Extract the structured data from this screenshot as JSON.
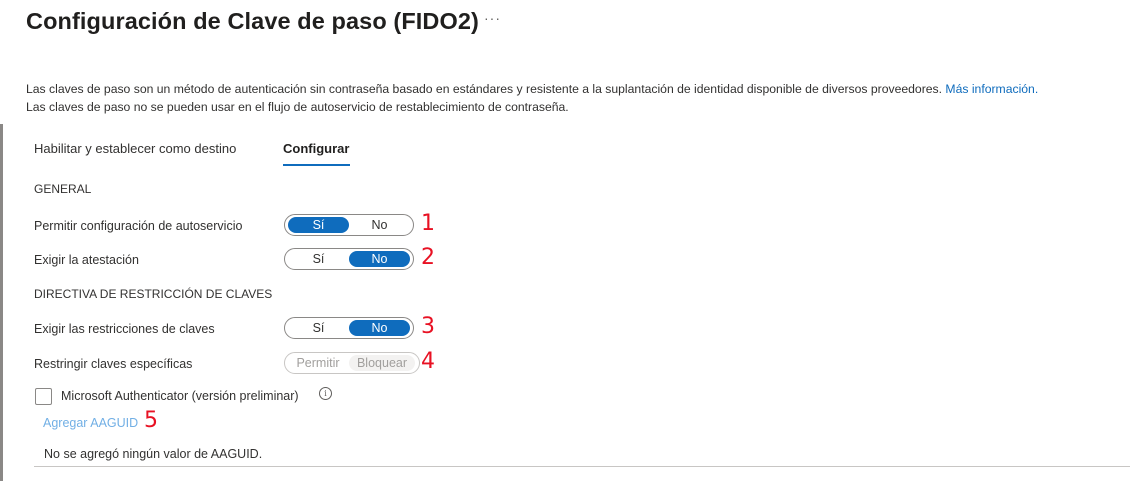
{
  "page": {
    "title": "Configuración de Clave de paso (FIDO2)",
    "more_label": "···"
  },
  "description": {
    "line1": "Las claves de paso son un método de autenticación sin contraseña basado en estándares y resistente a la suplantación de identidad disponible de diversos proveedores.",
    "link": "Más información.",
    "line2": "Las claves de paso no se pueden usar en el flujo de autoservicio de restablecimiento de contraseña."
  },
  "tabs": [
    {
      "label": "Habilitar y establecer como destino",
      "active": false
    },
    {
      "label": "Configurar",
      "active": true
    }
  ],
  "general": {
    "heading": "GENERAL",
    "self_service": {
      "label": "Permitir configuración de autoservicio",
      "on": "Sí",
      "off": "No",
      "selected": "Sí",
      "marker": "1"
    },
    "attestation": {
      "label": "Exigir la atestación",
      "on": "Sí",
      "off": "No",
      "selected": "No",
      "marker": "2"
    }
  },
  "key_restrictions": {
    "heading": "DIRECTIVA DE RESTRICCIÓN DE CLAVES",
    "enforce": {
      "label": "Exigir las restricciones de claves",
      "on": "Sí",
      "off": "No",
      "selected": "No",
      "marker": "3"
    },
    "restrict": {
      "label": "Restringir claves específicas",
      "on": "Permitir",
      "off": "Bloquear",
      "selected": "Bloquear",
      "disabled": true,
      "marker": "4"
    },
    "authenticator": {
      "label": "Microsoft Authenticator (versión preliminar)",
      "checked": false,
      "info_icon": "info-icon"
    },
    "add_aaguid": {
      "label": "Agregar AAGUID",
      "marker": "5"
    },
    "empty_message": "No se agregó ningún valor de AAGUID."
  },
  "colors": {
    "accent": "#0f6cbd",
    "marker": "#e81123"
  }
}
